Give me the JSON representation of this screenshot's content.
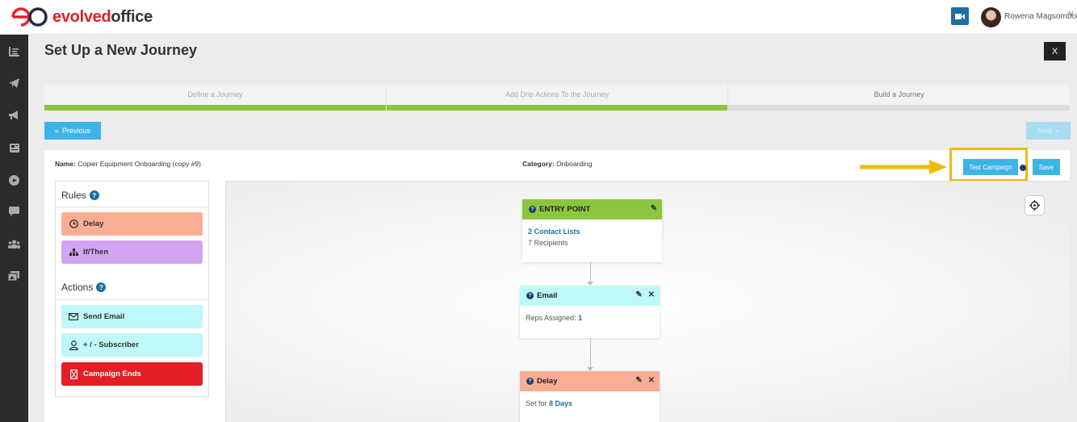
{
  "app": {
    "logo": {
      "text_brand": "evolved",
      "text_rest": "office"
    },
    "user": {
      "name": "Rowena Magsombol",
      "chevron": "∨"
    }
  },
  "sidebar": {
    "icons": [
      "analytics-icon",
      "send-icon",
      "megaphone-icon",
      "newspaper-icon",
      "play-icon",
      "chat-icon",
      "users-icon",
      "gallery-icon"
    ]
  },
  "page": {
    "title": "Set Up a New Journey",
    "close_label": "X"
  },
  "steps": [
    {
      "label": "Define a Journey",
      "complete": true
    },
    {
      "label": "Add Drip Actions To the Journey",
      "complete": true
    },
    {
      "label": "Build a Journey",
      "complete": false
    }
  ],
  "nav": {
    "previous_label": "Previous",
    "next_label": "Next"
  },
  "campaign": {
    "name_label": "Name:",
    "name_value": "Copier Equipment Onboarding (copy #9)",
    "category_label": "Category:",
    "category_value": "Onboarding",
    "test_label": "Test Campaign",
    "save_label": "Save"
  },
  "palette": {
    "rules_heading": "Rules",
    "actions_heading": "Actions",
    "help_glyph": "?",
    "rules": [
      {
        "label": "Delay",
        "icon": "clock-icon"
      },
      {
        "label": "If/Then",
        "icon": "sitemap-icon"
      }
    ],
    "actions": [
      {
        "label": "Send Email",
        "icon": "envelope-icon"
      },
      {
        "label": "+ / - Subscriber",
        "icon": "user-icon"
      },
      {
        "label": "Campaign Ends",
        "icon": "hourglass-icon"
      }
    ]
  },
  "flow": {
    "entry": {
      "title": "ENTRY POINT",
      "lists": "2 Contact Lists",
      "recipients_count": "7",
      "recipients_label": "Recipients"
    },
    "email": {
      "title": "Email",
      "reps_label": "Reps Assigned:",
      "reps_value": "1"
    },
    "delay": {
      "title": "Delay",
      "set_for_label": "Set for",
      "set_for_value": "8 Days"
    },
    "close_glyph": "✕"
  },
  "colors": {
    "accent": "#3cb4e6",
    "progress": "#8cc63f",
    "highlight": "#f2b90c",
    "brand_red": "#e21f26"
  }
}
